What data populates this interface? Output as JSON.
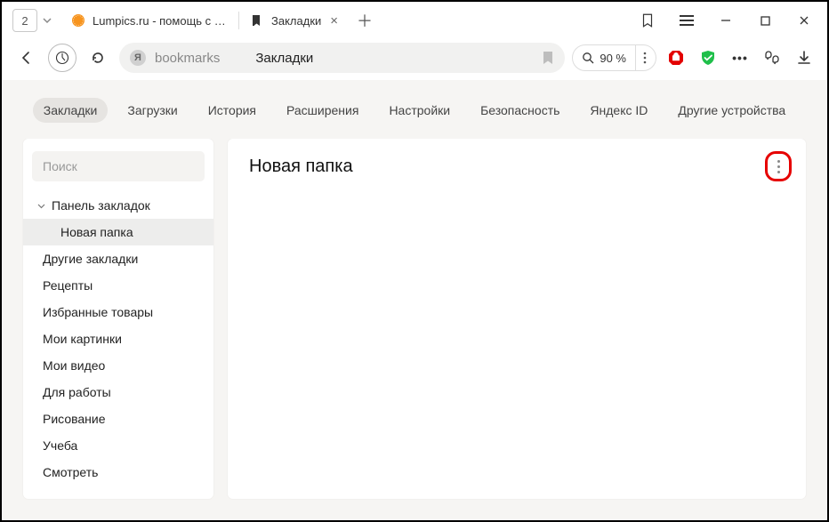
{
  "titlebar": {
    "tab_count": "2",
    "tabs": [
      {
        "label": "Lumpics.ru - помощь с компьютером",
        "favicon": "orange"
      },
      {
        "label": "Закладки",
        "favicon": "bookmark"
      }
    ]
  },
  "addr": {
    "url": "bookmarks",
    "title": "Закладки",
    "zoom": "90 %"
  },
  "nav": {
    "items": [
      "Закладки",
      "Загрузки",
      "История",
      "Расширения",
      "Настройки",
      "Безопасность",
      "Яндекс ID",
      "Другие устройства"
    ],
    "active_index": 0
  },
  "sidebar": {
    "search_placeholder": "Поиск",
    "root": "Панель закладок",
    "child_selected": "Новая папка",
    "items": [
      "Другие закладки",
      "Рецепты",
      "Избранные товары",
      "Мои картинки",
      "Мои видео",
      "Для работы",
      "Рисование",
      "Учеба",
      "Смотреть"
    ]
  },
  "main": {
    "heading": "Новая папка"
  }
}
